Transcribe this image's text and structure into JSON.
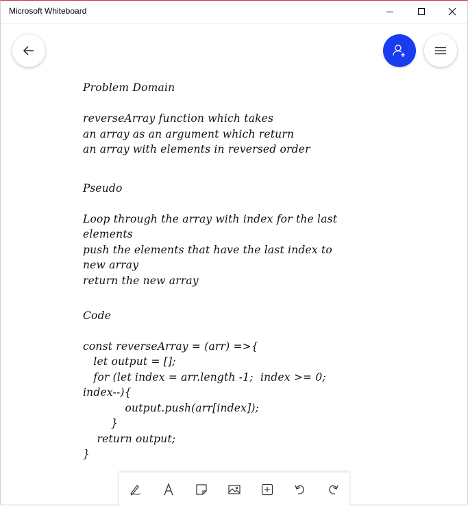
{
  "window": {
    "title": "Microsoft Whiteboard",
    "controls": {
      "minimize": "minimize-icon",
      "maximize": "maximize-icon",
      "close": "close-icon"
    }
  },
  "header": {
    "back_icon": "arrow-left-icon",
    "invite_icon": "person-add-icon",
    "menu_icon": "hamburger-menu-icon",
    "accent_color": "#1a3cf0"
  },
  "board": {
    "lines": [
      "Problem Domain",
      "reverseArray function which takes",
      "an array as an argument which return",
      "an array with elements in reversed order",
      "Pseudo",
      "Loop through the array with index for the last",
      "elements",
      "push the elements that have the last index to",
      "new array",
      "return the new array",
      "Code",
      "const reverseArray = (arr) =>{",
      "   let output = [];",
      "   for (let index = arr.length -1;  index >= 0;",
      "index--){",
      "            output.push(arr[index]);",
      "        }",
      "    return output;",
      "}"
    ]
  },
  "toolbar": {
    "tools": [
      "pen-icon",
      "text-icon",
      "sticky-note-icon",
      "image-icon",
      "add-icon",
      "undo-icon",
      "redo-icon"
    ]
  }
}
